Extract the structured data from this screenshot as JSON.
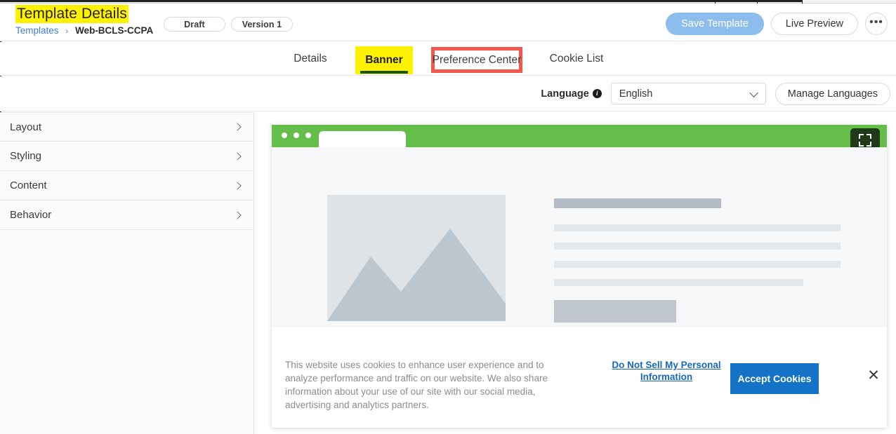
{
  "chrome": {
    "tab_seams": [
      1018,
      1078,
      1142,
      1390,
      1450,
      1512
    ]
  },
  "header": {
    "title": "Template Details",
    "breadcrumb": {
      "root": "Templates",
      "separator": "›",
      "current": "Web-BCLS-CCPA"
    },
    "status_pill": "Draft",
    "version_pill": "Version 1",
    "save_label": "Save Template",
    "preview_label": "Live Preview",
    "more_label": "•••"
  },
  "tabs": [
    {
      "label": "Details",
      "state": "inactive"
    },
    {
      "label": "Banner",
      "state": "active"
    },
    {
      "label": "Preference Center",
      "state": "annotated"
    },
    {
      "label": "Cookie List",
      "state": "inactive"
    }
  ],
  "language_bar": {
    "label": "Language",
    "info_glyph": "i",
    "selected": "English",
    "manage_label": "Manage Languages"
  },
  "sidebar": {
    "items": [
      {
        "label": "Layout"
      },
      {
        "label": "Styling"
      },
      {
        "label": "Content"
      },
      {
        "label": "Behavior"
      }
    ]
  },
  "preview": {
    "expand_icon": "fullscreen-icon",
    "cookie_banner": {
      "description": "This website uses cookies to enhance user experience and to analyze performance and traffic on our website. We also share information about your use of our site with our social media, advertising and analytics partners.",
      "link_label": "Do Not Sell My Personal Information",
      "accept_label": "Accept Cookies",
      "close_glyph": "✕"
    }
  },
  "colors": {
    "highlight_yellow": "#fff200",
    "annotation_red": "#f4574c",
    "active_tab_underline": "#17561b",
    "browser_green": "#65bd4a",
    "primary_blue": "#1473c6",
    "link_blue": "#1668c1",
    "save_disabled_blue": "#8cbdec"
  }
}
